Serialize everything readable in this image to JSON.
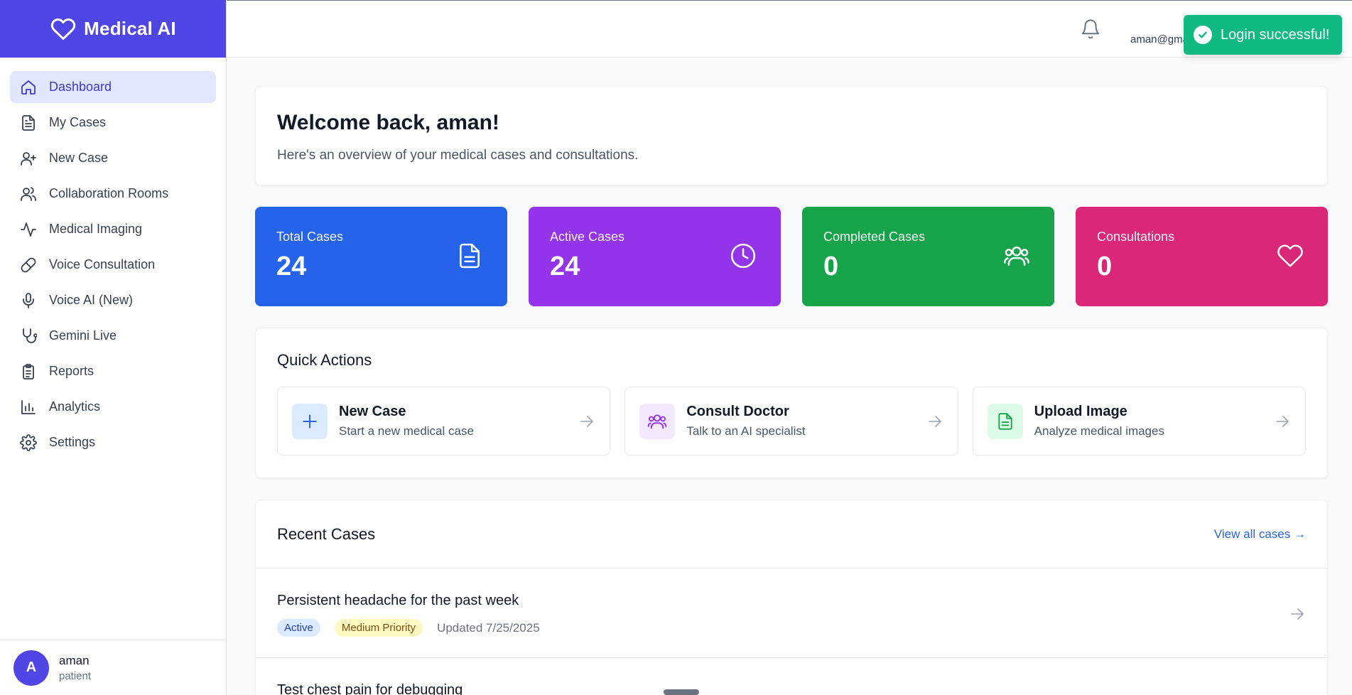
{
  "app": {
    "title": "Medical AI"
  },
  "sidebar": {
    "items": [
      {
        "label": "Dashboard",
        "icon": "home-icon",
        "active": true
      },
      {
        "label": "My Cases",
        "icon": "file-text-icon"
      },
      {
        "label": "New Case",
        "icon": "user-plus-icon"
      },
      {
        "label": "Collaboration Rooms",
        "icon": "users-icon"
      },
      {
        "label": "Medical Imaging",
        "icon": "activity-icon"
      },
      {
        "label": "Voice Consultation",
        "icon": "pill-icon"
      },
      {
        "label": "Voice AI (New)",
        "icon": "mic-icon"
      },
      {
        "label": "Gemini Live",
        "icon": "stethoscope-icon"
      },
      {
        "label": "Reports",
        "icon": "clipboard-icon"
      },
      {
        "label": "Analytics",
        "icon": "bar-chart-icon"
      },
      {
        "label": "Settings",
        "icon": "gear-icon"
      }
    ],
    "user": {
      "initial": "A",
      "name": "aman",
      "role": "patient"
    }
  },
  "header": {
    "email": "aman@gma"
  },
  "toast": {
    "message": "Login successful!"
  },
  "welcome": {
    "title": "Welcome back, aman!",
    "subtitle": "Here's an overview of your medical cases and consultations."
  },
  "stats": [
    {
      "label": "Total Cases",
      "value": "24",
      "color": "#2563eb",
      "icon": "file-icon"
    },
    {
      "label": "Active Cases",
      "value": "24",
      "color": "#9333ea",
      "icon": "clock-icon"
    },
    {
      "label": "Completed Cases",
      "value": "0",
      "color": "#16a34a",
      "icon": "users-icon"
    },
    {
      "label": "Consultations",
      "value": "0",
      "color": "#db2777",
      "icon": "heart-icon"
    }
  ],
  "quick_actions": {
    "title": "Quick Actions",
    "items": [
      {
        "title": "New Case",
        "subtitle": "Start a new medical case",
        "icon": "plus-icon",
        "bg": "#dbeafe",
        "fg": "#2563eb"
      },
      {
        "title": "Consult Doctor",
        "subtitle": "Talk to an AI specialist",
        "icon": "users-icon",
        "bg": "#f3e8ff",
        "fg": "#9333ea"
      },
      {
        "title": "Upload Image",
        "subtitle": "Analyze medical images",
        "icon": "file-icon",
        "bg": "#dcfce7",
        "fg": "#16a34a"
      }
    ]
  },
  "recent_cases": {
    "title": "Recent Cases",
    "view_all": "View all cases →",
    "items": [
      {
        "title": "Persistent headache for the past week",
        "status": "Active",
        "priority": "Medium Priority",
        "updated": "Updated 7/25/2025"
      },
      {
        "title": "Test chest pain for debugging"
      }
    ]
  }
}
